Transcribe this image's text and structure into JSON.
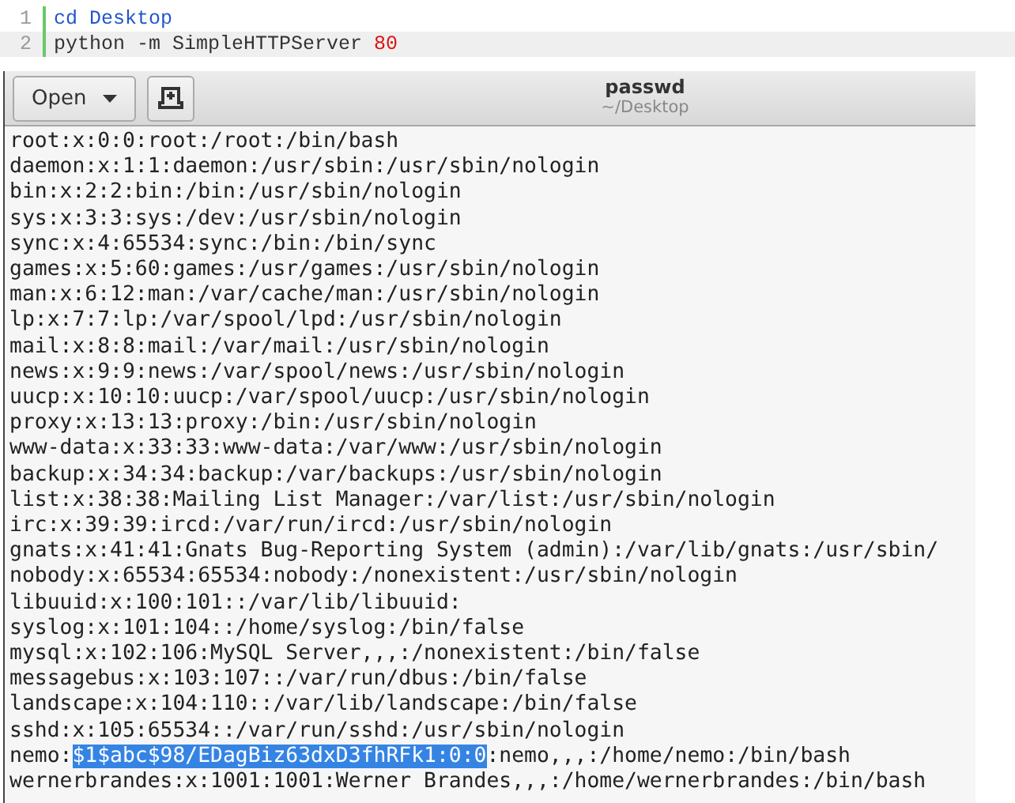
{
  "code_snippet": {
    "lines": [
      {
        "number": "1",
        "current": false,
        "tokens": [
          {
            "kind": "keyword",
            "text": "cd Desktop"
          }
        ]
      },
      {
        "number": "2",
        "current": true,
        "tokens": [
          {
            "kind": "plain",
            "text": "python -m SimpleHTTPServer "
          },
          {
            "kind": "number",
            "text": "80"
          }
        ]
      }
    ]
  },
  "editor": {
    "open_button": {
      "label": "Open"
    },
    "title": "passwd",
    "subtitle": "~/Desktop",
    "lines": [
      {
        "kind": "plain",
        "text": "root:x:0:0:root:/root:/bin/bash"
      },
      {
        "kind": "plain",
        "text": "daemon:x:1:1:daemon:/usr/sbin:/usr/sbin/nologin"
      },
      {
        "kind": "plain",
        "text": "bin:x:2:2:bin:/bin:/usr/sbin/nologin"
      },
      {
        "kind": "plain",
        "text": "sys:x:3:3:sys:/dev:/usr/sbin/nologin"
      },
      {
        "kind": "plain",
        "text": "sync:x:4:65534:sync:/bin:/bin/sync"
      },
      {
        "kind": "plain",
        "text": "games:x:5:60:games:/usr/games:/usr/sbin/nologin"
      },
      {
        "kind": "plain",
        "text": "man:x:6:12:man:/var/cache/man:/usr/sbin/nologin"
      },
      {
        "kind": "plain",
        "text": "lp:x:7:7:lp:/var/spool/lpd:/usr/sbin/nologin"
      },
      {
        "kind": "plain",
        "text": "mail:x:8:8:mail:/var/mail:/usr/sbin/nologin"
      },
      {
        "kind": "plain",
        "text": "news:x:9:9:news:/var/spool/news:/usr/sbin/nologin"
      },
      {
        "kind": "plain",
        "text": "uucp:x:10:10:uucp:/var/spool/uucp:/usr/sbin/nologin"
      },
      {
        "kind": "plain",
        "text": "proxy:x:13:13:proxy:/bin:/usr/sbin/nologin"
      },
      {
        "kind": "plain",
        "text": "www-data:x:33:33:www-data:/var/www:/usr/sbin/nologin"
      },
      {
        "kind": "plain",
        "text": "backup:x:34:34:backup:/var/backups:/usr/sbin/nologin"
      },
      {
        "kind": "plain",
        "text": "list:x:38:38:Mailing List Manager:/var/list:/usr/sbin/nologin"
      },
      {
        "kind": "plain",
        "text": "irc:x:39:39:ircd:/var/run/ircd:/usr/sbin/nologin"
      },
      {
        "kind": "plain",
        "text": "gnats:x:41:41:Gnats Bug-Reporting System (admin):/var/lib/gnats:/usr/sbin/"
      },
      {
        "kind": "plain",
        "text": "nobody:x:65534:65534:nobody:/nonexistent:/usr/sbin/nologin"
      },
      {
        "kind": "plain",
        "text": "libuuid:x:100:101::/var/lib/libuuid:"
      },
      {
        "kind": "plain",
        "text": "syslog:x:101:104::/home/syslog:/bin/false"
      },
      {
        "kind": "plain",
        "text": "mysql:x:102:106:MySQL Server,,,:/nonexistent:/bin/false"
      },
      {
        "kind": "plain",
        "text": "messagebus:x:103:107::/var/run/dbus:/bin/false"
      },
      {
        "kind": "plain",
        "text": "landscape:x:104:110::/var/lib/landscape:/bin/false"
      },
      {
        "kind": "plain",
        "text": "sshd:x:105:65534::/var/run/sshd:/usr/sbin/nologin"
      },
      {
        "kind": "selection",
        "before": "nemo:",
        "selected": "$1$abc$98/EDagBiz63dxD3fhRFk1:0:0",
        "after": ":nemo,,,:/home/nemo:/bin/bash"
      },
      {
        "kind": "plain",
        "text": "wernerbrandes:x:1001:1001:Werner Brandes,,,:/home/wernerbrandes:/bin/bash"
      }
    ]
  }
}
